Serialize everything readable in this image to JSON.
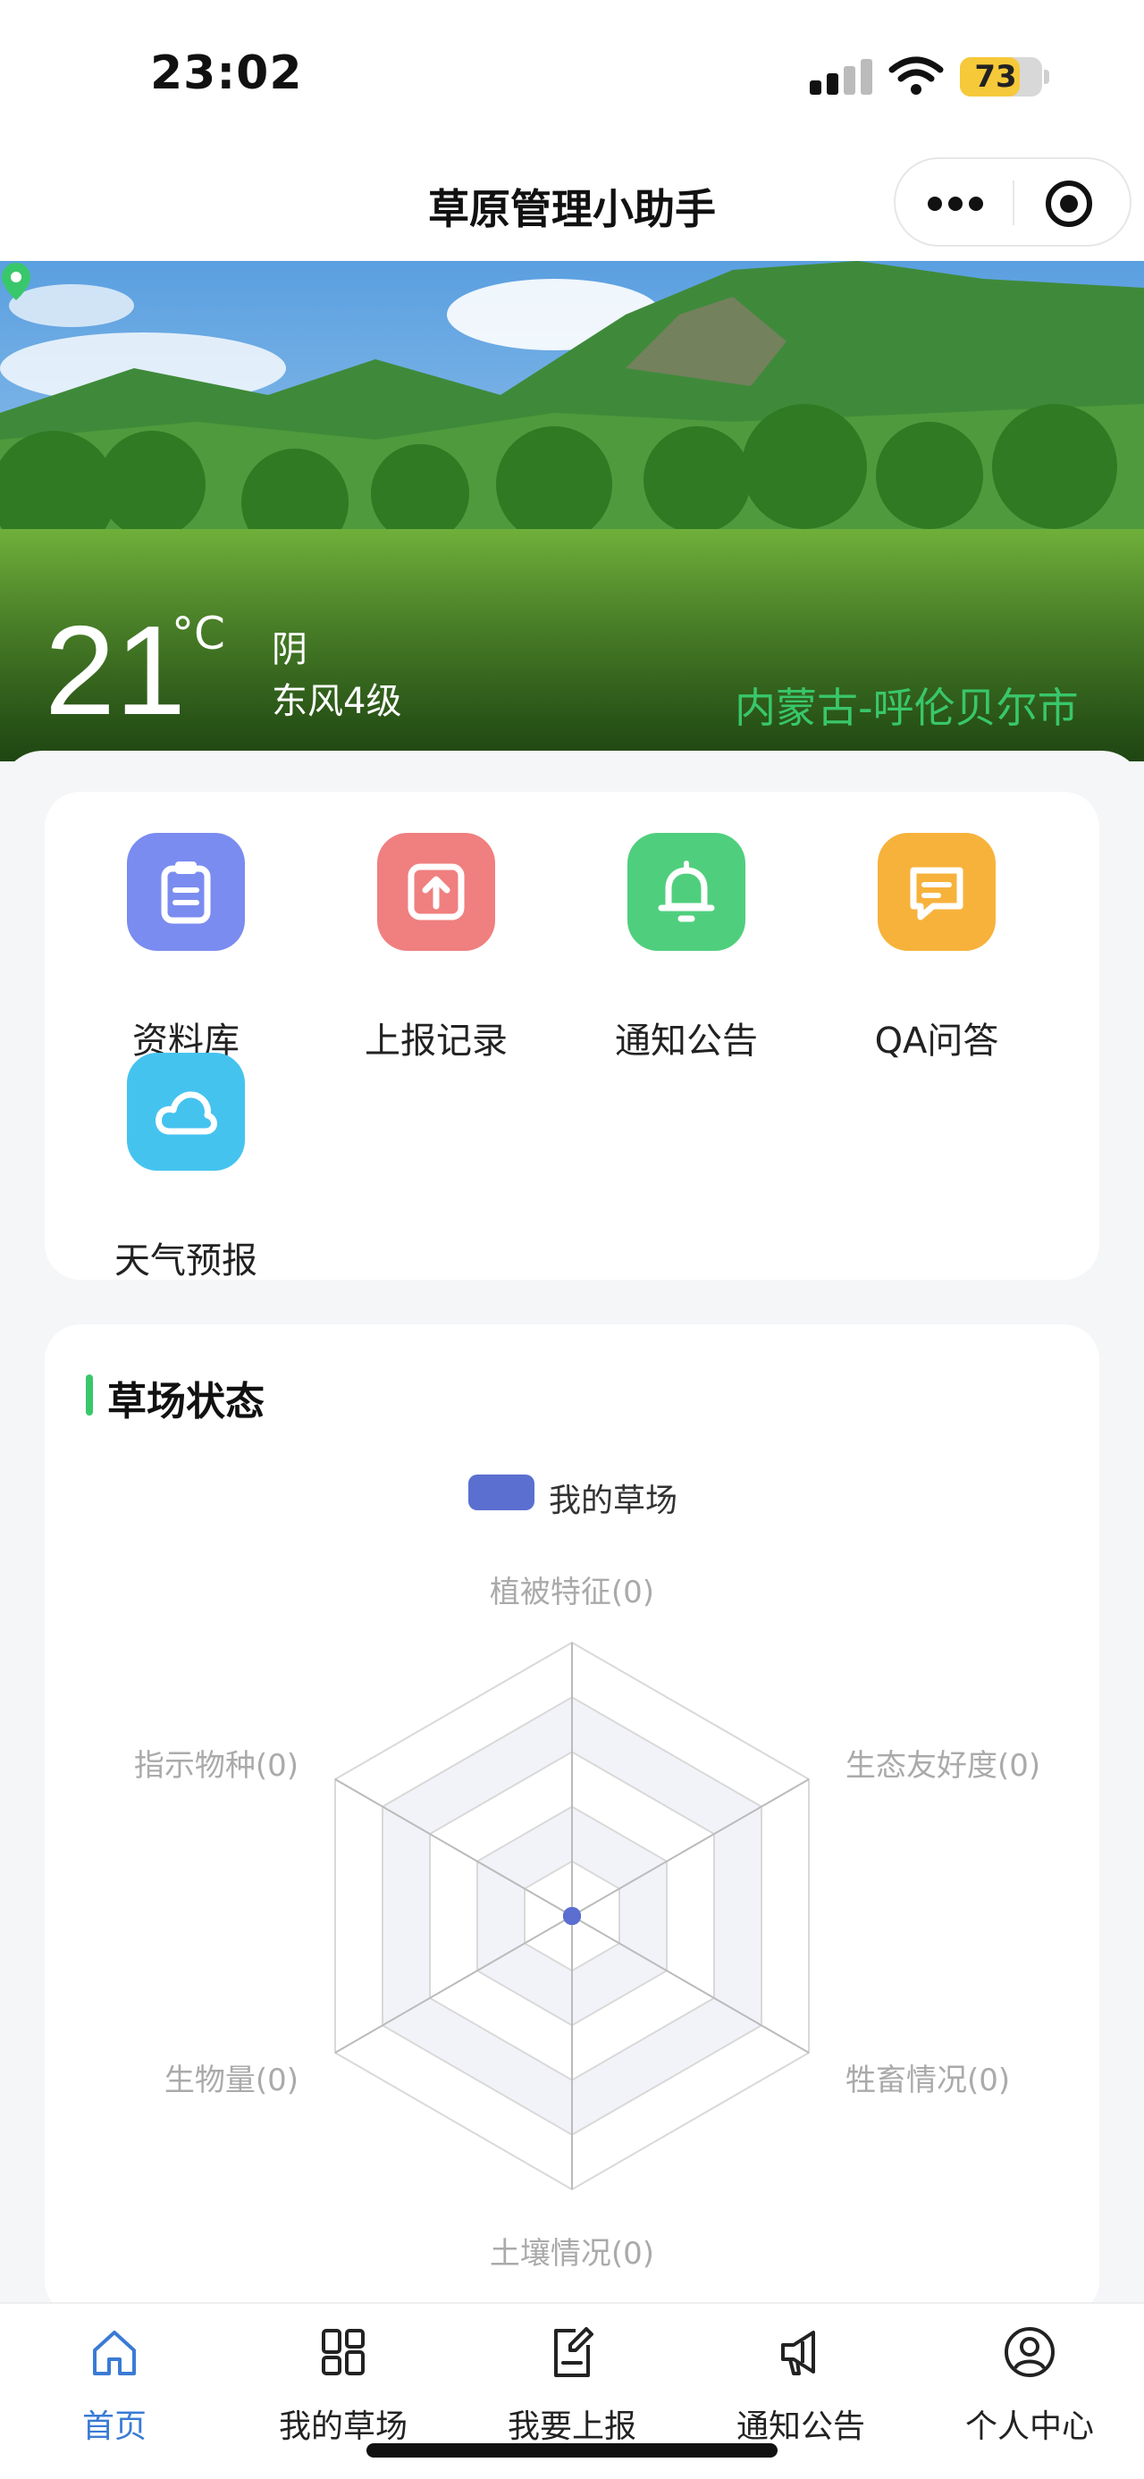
{
  "status_bar": {
    "time": "23:02",
    "battery": "73",
    "battery_level": 0.73
  },
  "navbar": {
    "title": "草原管理小助手"
  },
  "weather": {
    "temperature": "21",
    "unit": "°C",
    "condition": "阴",
    "wind": "东风4级",
    "location": "内蒙古-呼伦贝尔市"
  },
  "quick_actions": [
    {
      "label": "资料库",
      "icon": "clipboard-icon",
      "color": "#7b8cf0"
    },
    {
      "label": "上报记录",
      "icon": "upload-icon",
      "color": "#f07f7f"
    },
    {
      "label": "通知公告",
      "icon": "bell-icon",
      "color": "#4fcf7d"
    },
    {
      "label": "QA问答",
      "icon": "chat-icon",
      "color": "#f7b23b"
    },
    {
      "label": "天气预报",
      "icon": "cloud-icon",
      "color": "#45c3ef"
    }
  ],
  "grassland_status": {
    "title": "草场状态",
    "legend": "我的草场",
    "series_color": "#5b6fd0"
  },
  "chart_data": {
    "type": "radar",
    "title": "",
    "indicators": [
      "植被特征",
      "生态友好度",
      "牲畜情况",
      "土壤情况",
      "生物量",
      "指示物种"
    ],
    "tick_labels": [
      "植被特征(0)",
      "生态友好度(0)",
      "牲畜情况(0)",
      "土壤情况(0)",
      "生物量(0)",
      "指示物种(0)"
    ],
    "series": [
      {
        "name": "我的草场",
        "values": [
          0,
          0,
          0,
          0,
          0,
          0
        ]
      }
    ],
    "legend_position": "top"
  },
  "tabbar": {
    "items": [
      {
        "label": "首页",
        "icon": "home-icon",
        "active": true
      },
      {
        "label": "我的草场",
        "icon": "grid-icon",
        "active": false
      },
      {
        "label": "我要上报",
        "icon": "report-icon",
        "active": false
      },
      {
        "label": "通知公告",
        "icon": "megaphone-icon",
        "active": false
      },
      {
        "label": "个人中心",
        "icon": "user-icon",
        "active": false
      }
    ]
  }
}
